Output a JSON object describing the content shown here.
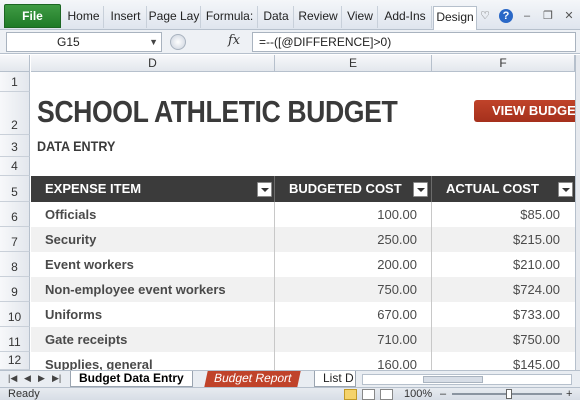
{
  "ribbon": {
    "tabs": [
      "File",
      "Home",
      "Insert",
      "Page Lay",
      "Formula:",
      "Data",
      "Review",
      "View",
      "Add-Ins",
      "Design"
    ]
  },
  "formula_bar": {
    "name_box": "G15",
    "fx": "fx",
    "formula": "=--([@DIFFERENCE]>0)"
  },
  "columns": [
    "D",
    "E",
    "F"
  ],
  "rows": [
    "1",
    "2",
    "3",
    "4",
    "5",
    "6",
    "7",
    "8",
    "9",
    "10",
    "11",
    "12"
  ],
  "sheet": {
    "title": "SCHOOL ATHLETIC BUDGET",
    "subtitle": "DATA ENTRY",
    "view_button": "VIEW BUDGE",
    "headers": {
      "item": "EXPENSE ITEM",
      "budgeted": "BUDGETED COST",
      "actual": "ACTUAL COST"
    },
    "data_rows": [
      {
        "item": "Officials",
        "budgeted": "100.00",
        "actual": "$85.00"
      },
      {
        "item": "Security",
        "budgeted": "250.00",
        "actual": "$215.00"
      },
      {
        "item": "Event workers",
        "budgeted": "200.00",
        "actual": "$210.00"
      },
      {
        "item": "Non-employee event workers",
        "budgeted": "750.00",
        "actual": "$724.00"
      },
      {
        "item": "Uniforms",
        "budgeted": "670.00",
        "actual": "$733.00"
      },
      {
        "item": "Gate receipts",
        "budgeted": "710.00",
        "actual": "$750.00"
      },
      {
        "item": "Supplies, general",
        "budgeted": "160.00",
        "actual": "$145.00"
      }
    ]
  },
  "sheet_tabs": [
    "Budget Data Entry",
    "Budget Report",
    "List D"
  ],
  "status": {
    "ready": "Ready",
    "zoom": "100%"
  },
  "colors": {
    "file_tab": "#207b28",
    "accent_red": "#b3391f",
    "header_dark": "#3b3b3b"
  }
}
